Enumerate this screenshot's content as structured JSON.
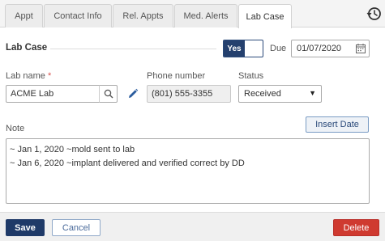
{
  "tabs": [
    {
      "label": "Appt"
    },
    {
      "label": "Contact Info"
    },
    {
      "label": "Rel. Appts"
    },
    {
      "label": "Med. Alerts"
    },
    {
      "label": "Lab Case",
      "active": true
    }
  ],
  "header_icon": "history-clock-icon",
  "section": {
    "title": "Lab Case"
  },
  "toggle": {
    "label": "Yes",
    "state": "on"
  },
  "due": {
    "label": "Due",
    "value": "01/07/2020",
    "icon": "calendar-icon"
  },
  "lab_name": {
    "label": "Lab name",
    "required_mark": "*",
    "value": "ACME Lab",
    "search_icon": "search-icon",
    "edit_icon": "pencil-icon"
  },
  "phone": {
    "label": "Phone number",
    "value": "(801) 555-3355"
  },
  "status": {
    "label": "Status",
    "value": "Received"
  },
  "note": {
    "label": "Note",
    "insert_date_label": "Insert Date",
    "lines": [
      "~ Jan 1, 2020 ~mold sent to lab",
      "~ Jan 6, 2020 ~implant delivered and verified correct by DD"
    ]
  },
  "footer": {
    "save_label": "Save",
    "cancel_label": "Cancel",
    "delete_label": "Delete"
  },
  "colors": {
    "primary": "#1f3a68",
    "danger": "#cf3a30",
    "required": "#d9534f"
  }
}
